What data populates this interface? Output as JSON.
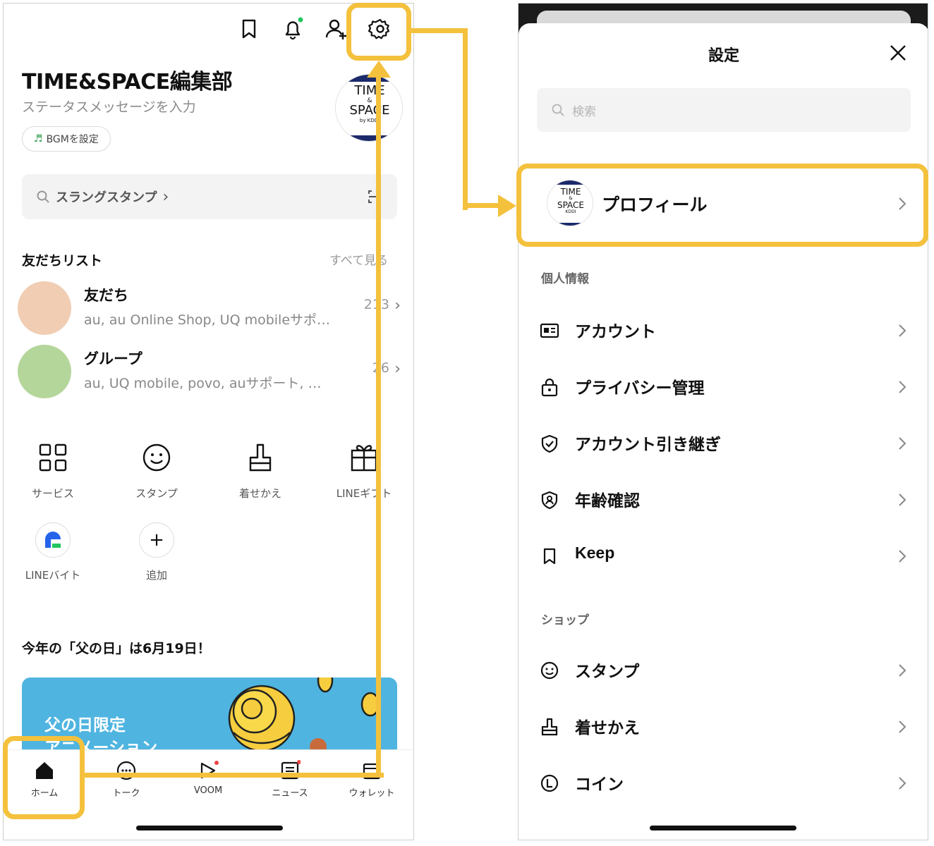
{
  "left": {
    "profile": {
      "name": "TIME&SPACE編集部",
      "status_placeholder": "ステータスメッセージを入力",
      "bgm_label": "BGMを設定",
      "logo_text_1": "TIME",
      "logo_text_2": "&",
      "logo_text_3": "SPACE",
      "logo_text_4": "by KDDI"
    },
    "top_icons": [
      "bookmark-icon",
      "bell-icon",
      "add-friend-icon",
      "gear-icon"
    ],
    "search": {
      "label": "スラングスタンプ",
      "chevron": "›"
    },
    "friends": {
      "title": "友だちリスト",
      "see_all": "すべて見る",
      "rows": [
        {
          "title": "友だち",
          "sub": "au, au Online Shop, UQ mobileサポ…",
          "count": "213",
          "color": "#f0cdb3"
        },
        {
          "title": "グループ",
          "sub": "au, UQ mobile, povo, auサポート, …",
          "count": "26",
          "color": "#b5d69b"
        }
      ]
    },
    "services": [
      {
        "label": "サービス",
        "icon": "grid-icon"
      },
      {
        "label": "スタンプ",
        "icon": "smile-icon"
      },
      {
        "label": "着せかえ",
        "icon": "brush-icon"
      },
      {
        "label": "LINEギフト",
        "icon": "gift-icon"
      },
      {
        "label": "LINEバイト",
        "icon": "line-baito-icon"
      },
      {
        "label": "追加",
        "icon": "plus-icon"
      }
    ],
    "promo": {
      "title": "今年の「父の日」は6月19日！",
      "banner_line_1": "父の日限定",
      "banner_line_2": "アニメーション"
    },
    "tabs": [
      {
        "label": "ホーム",
        "icon": "home-icon"
      },
      {
        "label": "トーク",
        "icon": "chat-icon"
      },
      {
        "label": "VOOM",
        "icon": "voom-icon"
      },
      {
        "label": "ニュース",
        "icon": "news-icon"
      },
      {
        "label": "ウォレット",
        "icon": "wallet-icon"
      }
    ]
  },
  "right": {
    "title": "設定",
    "search_placeholder": "検索",
    "profile_label": "プロフィール",
    "logo_text_1": "TIME",
    "logo_text_2": "&",
    "logo_text_3": "SPACE",
    "logo_text_4": "KDDI",
    "sections": [
      {
        "title": "個人情報",
        "items": [
          {
            "label": "アカウント",
            "icon": "id-card-icon"
          },
          {
            "label": "プライバシー管理",
            "icon": "lock-icon"
          },
          {
            "label": "アカウント引き継ぎ",
            "icon": "shield-check-icon"
          },
          {
            "label": "年齢確認",
            "icon": "age-verify-icon"
          },
          {
            "label": "Keep",
            "icon": "bookmark-icon"
          }
        ]
      },
      {
        "title": "ショップ",
        "items": [
          {
            "label": "スタンプ",
            "icon": "smile-icon"
          },
          {
            "label": "着せかえ",
            "icon": "brush-icon"
          },
          {
            "label": "コイン",
            "icon": "coin-icon"
          }
        ]
      }
    ]
  },
  "colors": {
    "highlight": "#f4c13d",
    "banner": "#4fb4e0",
    "notify_green": "#22c55e",
    "notify_red": "#ef4444"
  }
}
